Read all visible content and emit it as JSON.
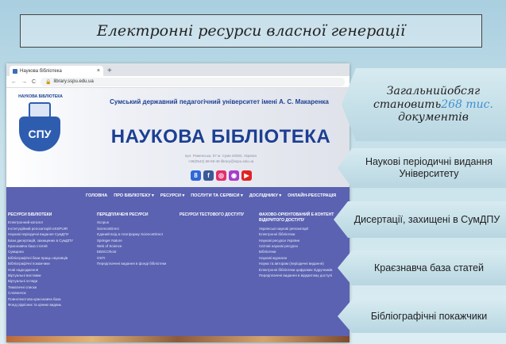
{
  "slide": {
    "title": "Електронні ресурси власної генерації"
  },
  "browser": {
    "tab_title": "Наукова бібліотека",
    "tab_close": "×",
    "new_tab": "+",
    "nav_back": "←",
    "nav_forward": "→",
    "nav_reload": "C",
    "url": "library.sspu.edu.ua"
  },
  "site": {
    "logo_caption": "НАУКОВА БІБЛІОТЕКА",
    "logo_abbr": "СПУ",
    "university": "Сумський державний педагогічний університет імені А. С. Макаренка",
    "library": "НАУКОВА БІБЛІОТЕКА",
    "address": "вул. Роменська, 87 м. Суми 40002, Україна",
    "contacts": "+38(0542) 68-59-48  library@sspu.edu.ua",
    "socials": [
      "8",
      "f",
      "◎",
      "◉",
      "▶"
    ],
    "nav": [
      "ГОЛОВНА",
      "ПРО БІБЛІОТЕКУ ▾",
      "РЕСУРСИ ▾",
      "ПОСЛУГИ ТА СЕРВІСИ ▾",
      "ДОСЛІДНИКУ ▾",
      "ОНЛАЙН-РЕЄСТРАЦІЯ"
    ],
    "columns": [
      {
        "heading": "РЕСУРСИ БІБЛІОТЕКИ",
        "items": [
          "Електронний каталог",
          "Інституційний репозитарій eSSPUIR",
          "Наукові періодичні видання СумДПУ",
          "Бази дисертацій, захищених в СумДПУ",
          "Краєзнавча база статей",
          "Сумщина",
          "Бібліографічні бази праць науковців",
          "Бібліографічні покажчики",
          "Нові надходження",
          "Віртуальні виставки",
          "Віртуальні огляди",
          "Тематичні списки",
          "Словничок",
          "Повнотекстова краєзнавча база",
          "Фонд рідкісних та цінних видань"
        ]
      },
      {
        "heading": "ПЕРЕДПЛАЧЕНІ РЕСУРСИ",
        "items": [
          "Scopus",
          "ScienceDirect",
          "Єдиний вхід в платформу ScienceDirect",
          "Springer Nature",
          "Web of Science",
          "EBSCOhost",
          "OSTI",
          "Передплачені видання в фонді бібліотеки"
        ]
      },
      {
        "heading": "РЕСУРСИ ТЕСТОВОГО ДОСТУПУ",
        "items": []
      },
      {
        "heading": "ФАХОВО-ОРІЄНТОВАНИЙ Е-КОНТЕНТ ВІДКРИТОГО ДОСТУПУ",
        "items": [
          "Українські наукові репозитарії",
          "Електронні бібліотеки",
          "Наукові ресурси України",
          "Світові наукові ресурси",
          "Бібліотеки",
          "Наукові журнали",
          "Наука та авторам (періодичні видання)",
          "Електронні бібліотеки цифрових підручників",
          "Передплачені видання в відкритому доступі"
        ]
      }
    ]
  },
  "banners": {
    "total_prefix": "Загальнийобсяг",
    "total_verb": "становить",
    "total_value": "268 тис.",
    "total_suffix": "документів",
    "b2": "Наукові періодичні видання Університету",
    "b3": "Дисертації, захищені в СумДПУ",
    "b4": "Краєзнавча база статей",
    "b5": "Бібліографічні покажчики"
  },
  "colors": {
    "brand_blue": "#1c3f92",
    "nav_purple": "#5b62b1",
    "accent": "#3e8ed0"
  }
}
